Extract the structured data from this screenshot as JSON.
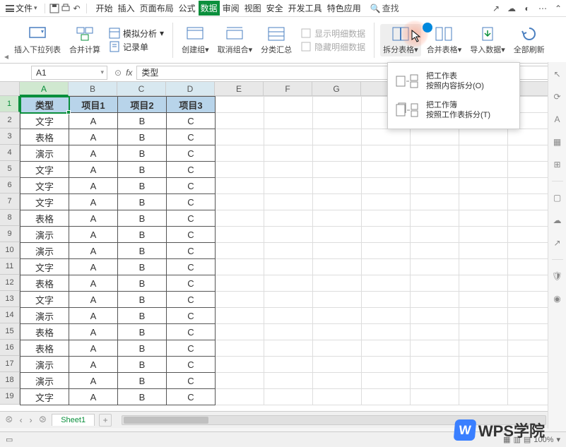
{
  "menu": {
    "file": "文件",
    "tabs": [
      "开始",
      "插入",
      "页面布局",
      "公式",
      "数据",
      "审阅",
      "视图",
      "安全",
      "开发工具",
      "特色应用"
    ],
    "active_tab": "数据",
    "search": "查找"
  },
  "ribbon": {
    "insert_dropdown": "插入下拉列表",
    "merge_calc": "合并计算",
    "sim_analysis": "模拟分析",
    "record_form": "记录单",
    "create_group": "创建组",
    "ungroup": "取消组合",
    "subtotal": "分类汇总",
    "show_detail": "显示明细数据",
    "hide_detail": "隐藏明细数据",
    "split_table": "拆分表格",
    "merge_table": "合并表格",
    "import_data": "导入数据",
    "refresh_all": "全部刷新"
  },
  "dropdown": {
    "item1_title": "把工作表",
    "item1_sub": "按照内容拆分(O)",
    "item2_title": "把工作簿",
    "item2_sub": "按照工作表拆分(T)"
  },
  "formula": {
    "name_box": "A1",
    "fx": "fx",
    "value": "类型"
  },
  "grid": {
    "cols": [
      "A",
      "B",
      "C",
      "D",
      "E",
      "F",
      "G"
    ],
    "headers": [
      "类型",
      "项目1",
      "项目2",
      "项目3"
    ],
    "rows": [
      [
        "文字",
        "A",
        "B",
        "C"
      ],
      [
        "表格",
        "A",
        "B",
        "C"
      ],
      [
        "演示",
        "A",
        "B",
        "C"
      ],
      [
        "文字",
        "A",
        "B",
        "C"
      ],
      [
        "文字",
        "A",
        "B",
        "C"
      ],
      [
        "文字",
        "A",
        "B",
        "C"
      ],
      [
        "表格",
        "A",
        "B",
        "C"
      ],
      [
        "演示",
        "A",
        "B",
        "C"
      ],
      [
        "演示",
        "A",
        "B",
        "C"
      ],
      [
        "文字",
        "A",
        "B",
        "C"
      ],
      [
        "表格",
        "A",
        "B",
        "C"
      ],
      [
        "文字",
        "A",
        "B",
        "C"
      ],
      [
        "演示",
        "A",
        "B",
        "C"
      ],
      [
        "表格",
        "A",
        "B",
        "C"
      ],
      [
        "表格",
        "A",
        "B",
        "C"
      ],
      [
        "演示",
        "A",
        "B",
        "C"
      ],
      [
        "演示",
        "A",
        "B",
        "C"
      ],
      [
        "文字",
        "A",
        "B",
        "C"
      ]
    ]
  },
  "sheet": {
    "name": "Sheet1"
  },
  "status": {
    "zoom": "100%"
  },
  "watermark": "WPS学院"
}
